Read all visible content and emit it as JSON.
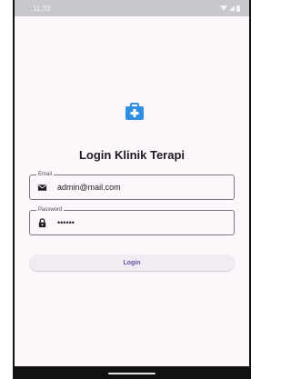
{
  "status_bar": {
    "time": "11:33"
  },
  "app": {
    "logo_icon": "medical-kit-icon",
    "title": "Login Klinik Terapi",
    "accent_color": "#2f8fe0"
  },
  "form": {
    "email": {
      "label": "Email",
      "value": "admin@mail.com",
      "icon": "mail-icon"
    },
    "password": {
      "label": "Password",
      "value": "••••••",
      "icon": "lock-icon"
    },
    "login_label": "Login"
  }
}
